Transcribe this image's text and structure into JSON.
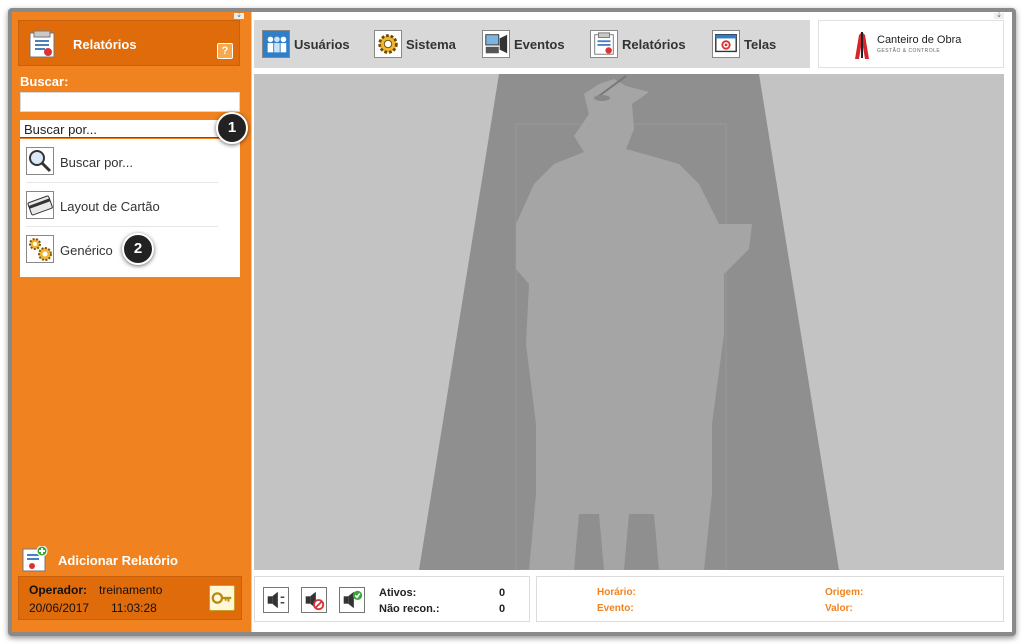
{
  "sidebar": {
    "header_title": "Relatórios",
    "help_label": "?",
    "search_label": "Buscar:",
    "search_value": "",
    "dropdown_selected": "Buscar por...",
    "dropdown_items": [
      {
        "label": "Buscar por...",
        "icon": "magnifier-icon"
      },
      {
        "label": "Layout de Cartão",
        "icon": "card-icon"
      },
      {
        "label": "Genérico",
        "icon": "gears-icon"
      }
    ],
    "add_report_label": "Adicionar Relatório",
    "operator_label": "Operador:",
    "operator_name": "treinamento",
    "date": "20/06/2017",
    "time": "11:03:28"
  },
  "toolbar": {
    "items": [
      {
        "label": "Usuários",
        "icon": "users-icon"
      },
      {
        "label": "Sistema",
        "icon": "gear-icon"
      },
      {
        "label": "Eventos",
        "icon": "events-icon"
      },
      {
        "label": "Relatórios",
        "icon": "reports-icon"
      },
      {
        "label": "Telas",
        "icon": "screens-icon"
      }
    ]
  },
  "logo": {
    "text": "Canteiro de Obra",
    "subtext": "GESTÃO & CONTROLE"
  },
  "status": {
    "active_label": "Ativos:",
    "active_value": "0",
    "unrecognized_label": "Não recon.:",
    "unrecognized_value": "0",
    "time_label": "Horário:",
    "event_label": "Evento:",
    "origin_label": "Origem:",
    "value_label": "Valor:"
  },
  "callouts": [
    "1",
    "2"
  ],
  "colors": {
    "sidebar": "#f0831f",
    "sidebar_dark": "#e06b0b",
    "main_bg": "#c3c3c3",
    "silhouette": "#a5a5a5",
    "beam": "#8f8f8f",
    "accent_label": "#f0831f"
  }
}
